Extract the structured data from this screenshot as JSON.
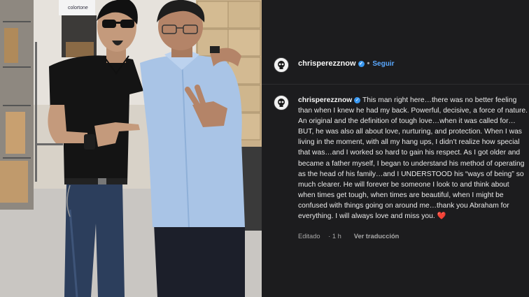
{
  "post": {
    "username": "chrisperezznow",
    "follow_label": "Seguir",
    "separator": "•",
    "verified_glyph": "✓",
    "caption": "This man right here…there was no better feeling than when I knew he had my back. Powerful, decisive, a force of nature. An original and the definition of tough love…when it was called for…BUT, he was also all about love, nurturing, and protection. When I was living in the moment, with all my hang ups, I didn’t realize how special that was…and I worked so hard to gain his respect. As I got older and became a father myself, I began to understand his method of operating as the head of his family…and I UNDERSTOOD his “ways of being” so much clearer. He will forever be someone I look to and think about when times get tough, when times are beautiful, when I might be confused with things going on around me…thank you Abraham for everything. I will always love and miss you.",
    "heart": "❤️",
    "edited_label": "Editado",
    "time_label": "1 h",
    "translate_label": "Ver traducción"
  },
  "photo": {
    "box_brand": "colortone"
  },
  "colors": {
    "background": "#1c1c1e",
    "link_blue": "#5aa8ff",
    "verified_blue": "#3897f0",
    "heart_red": "#ed4956"
  },
  "icons": {
    "avatar": "skull-emblem-icon",
    "verified": "verified-badge-icon"
  }
}
